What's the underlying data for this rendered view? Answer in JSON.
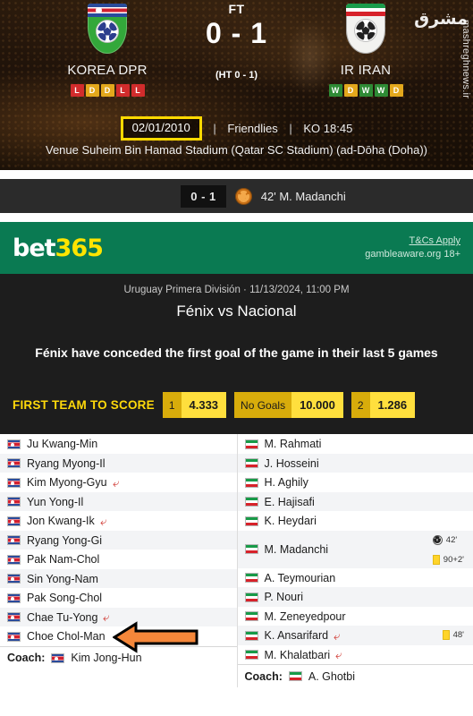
{
  "match": {
    "status": "FT",
    "score": "0 - 1",
    "halftime": "(HT 0 - 1)",
    "home": {
      "name": "KOREA DPR",
      "form": [
        "L",
        "D",
        "D",
        "L",
        "L"
      ]
    },
    "away": {
      "name": "IR IRAN",
      "form": [
        "W",
        "D",
        "W",
        "W",
        "D"
      ]
    },
    "date": "02/01/2010",
    "competition": "Friendlies",
    "kickoff": "KO 18:45",
    "venue": "Venue Suheim Bin Hamad Stadium (Qatar SC Stadium) (ad-Dōha (Doha))",
    "watermark_fa": "مشرق",
    "watermark_url": "mashreghnews.ir"
  },
  "goal_strip": {
    "score": "0 - 1",
    "scorer": "42' M. Madanchi"
  },
  "bet365": {
    "logo_bet": "bet",
    "logo_365": "365",
    "tcs": "T&Cs Apply",
    "gambleaware": "gambleaware.org 18+",
    "league_line": "Uruguay Primera División  ·  11/13/2024, 11:00 PM",
    "fixture": "Fénix vs Nacional",
    "stat": "Fénix have conceded the first goal of the game in their last 5 games",
    "odds_title": "FIRST TEAM TO SCORE",
    "odds": [
      {
        "label": "1",
        "value": "4.333"
      },
      {
        "label": "No Goals",
        "value": "10.000"
      },
      {
        "label": "2",
        "value": "1.286"
      }
    ],
    "colors": {
      "banner_green": "#0a7a52",
      "logo_yellow": "#ffe400",
      "odds_yellow": "#ffdf3d",
      "odds_gold": "#d8ac0b"
    }
  },
  "lineups": {
    "home": {
      "flag": "kp",
      "coach_label": "Coach:",
      "coach_name": "Kim Jong-Hun",
      "players": [
        {
          "name": "Ju Kwang-Min",
          "sub": false,
          "events": []
        },
        {
          "name": "Ryang Myong-Il",
          "sub": false,
          "events": []
        },
        {
          "name": "Kim Myong-Gyu",
          "sub": true,
          "events": []
        },
        {
          "name": "Yun Yong-Il",
          "sub": false,
          "events": []
        },
        {
          "name": "Jon Kwang-Ik",
          "sub": true,
          "events": []
        },
        {
          "name": "Ryang Yong-Gi",
          "sub": false,
          "events": []
        },
        {
          "name": "Pak Nam-Chol",
          "sub": false,
          "events": []
        },
        {
          "name": "Sin Yong-Nam",
          "sub": false,
          "events": []
        },
        {
          "name": "Pak Song-Chol",
          "sub": false,
          "events": []
        },
        {
          "name": "Chae Tu-Yong",
          "sub": true,
          "events": []
        },
        {
          "name": "Choe Chol-Man",
          "sub": false,
          "events": []
        }
      ]
    },
    "away": {
      "flag": "ir",
      "coach_label": "Coach:",
      "coach_name": "A. Ghotbi",
      "players": [
        {
          "name": "M. Rahmati",
          "sub": false,
          "events": []
        },
        {
          "name": "J. Hosseini",
          "sub": false,
          "events": []
        },
        {
          "name": "H. Aghily",
          "sub": false,
          "events": []
        },
        {
          "name": "E. Hajisafi",
          "sub": false,
          "events": []
        },
        {
          "name": "K. Heydari",
          "sub": false,
          "events": []
        },
        {
          "name": "M. Madanchi",
          "sub": false,
          "events": [
            {
              "type": "goal",
              "minute": "42'"
            },
            {
              "type": "yellow",
              "minute": "90+2'"
            }
          ]
        },
        {
          "name": "A. Teymourian",
          "sub": false,
          "events": []
        },
        {
          "name": "P. Nouri",
          "sub": false,
          "events": []
        },
        {
          "name": "M. Zeneyedpour",
          "sub": false,
          "events": []
        },
        {
          "name": "K. Ansarifard",
          "sub": true,
          "events": [
            {
              "type": "yellow",
              "minute": "48'"
            }
          ]
        },
        {
          "name": "M. Khalatbari",
          "sub": true,
          "events": []
        }
      ]
    }
  },
  "annotations": {
    "date_highlight_color": "#ffd900",
    "pointer_arrow_color": "#f5873a",
    "pointer_target": "Sin Yong-Nam"
  }
}
